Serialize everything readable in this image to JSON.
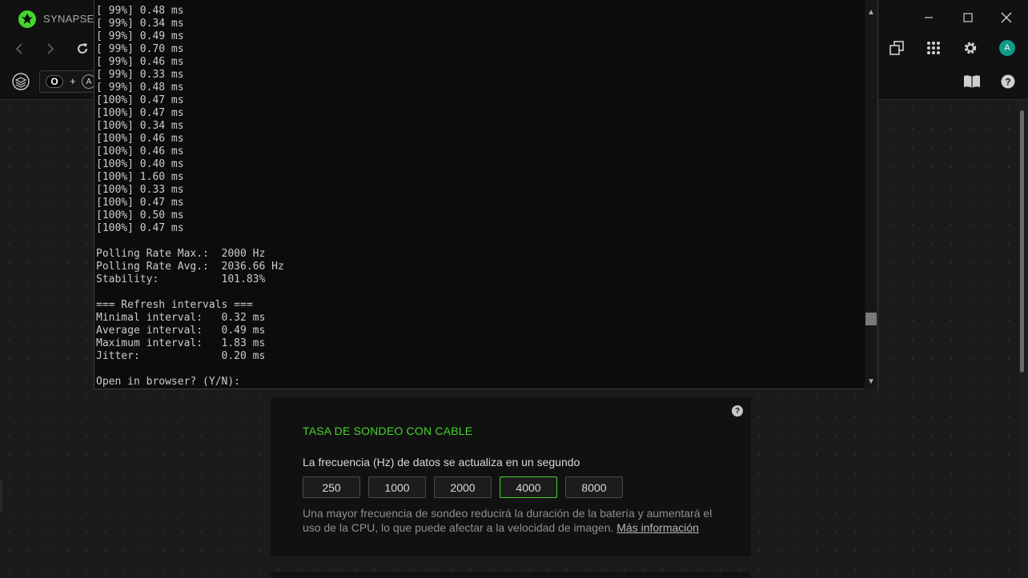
{
  "app": {
    "name": "SYNAPSE",
    "brand_color": "#44d62c",
    "avatar_initial": "A"
  },
  "toolbar": {
    "chip_button_label": "O",
    "chip_plus": "+",
    "chip_key": "A"
  },
  "console": {
    "lines": [
      "[ 99%] 0.48 ms",
      "[ 99%] 0.34 ms",
      "[ 99%] 0.49 ms",
      "[ 99%] 0.70 ms",
      "[ 99%] 0.46 ms",
      "[ 99%] 0.33 ms",
      "[ 99%] 0.48 ms",
      "[100%] 0.47 ms",
      "[100%] 0.47 ms",
      "[100%] 0.34 ms",
      "[100%] 0.46 ms",
      "[100%] 0.46 ms",
      "[100%] 0.40 ms",
      "[100%] 1.60 ms",
      "[100%] 0.33 ms",
      "[100%] 0.47 ms",
      "[100%] 0.50 ms",
      "[100%] 0.47 ms",
      "",
      "Polling Rate Max.:  2000 Hz",
      "Polling Rate Avg.:  2036.66 Hz",
      "Stability:          101.83%",
      "",
      "=== Refresh intervals ===",
      "Minimal interval:   0.32 ms",
      "Average interval:   0.49 ms",
      "Maximum interval:   1.83 ms",
      "Jitter:             0.20 ms",
      "",
      "Open in browser? (Y/N):"
    ],
    "scroll_position": 0.87
  },
  "polling_card": {
    "help": "?",
    "title": "TASA DE SONDEO CON CABLE",
    "subtitle": "La frecuencia (Hz) de datos se actualiza en un segundo",
    "options": [
      "250",
      "1000",
      "2000",
      "4000",
      "8000"
    ],
    "selected": "4000",
    "description": "Una mayor frecuencia de sondeo reducirá la duración de la batería y aumentará el uso de la CPU, lo que puede afectar a la velocidad de imagen.",
    "link": "Más información"
  }
}
